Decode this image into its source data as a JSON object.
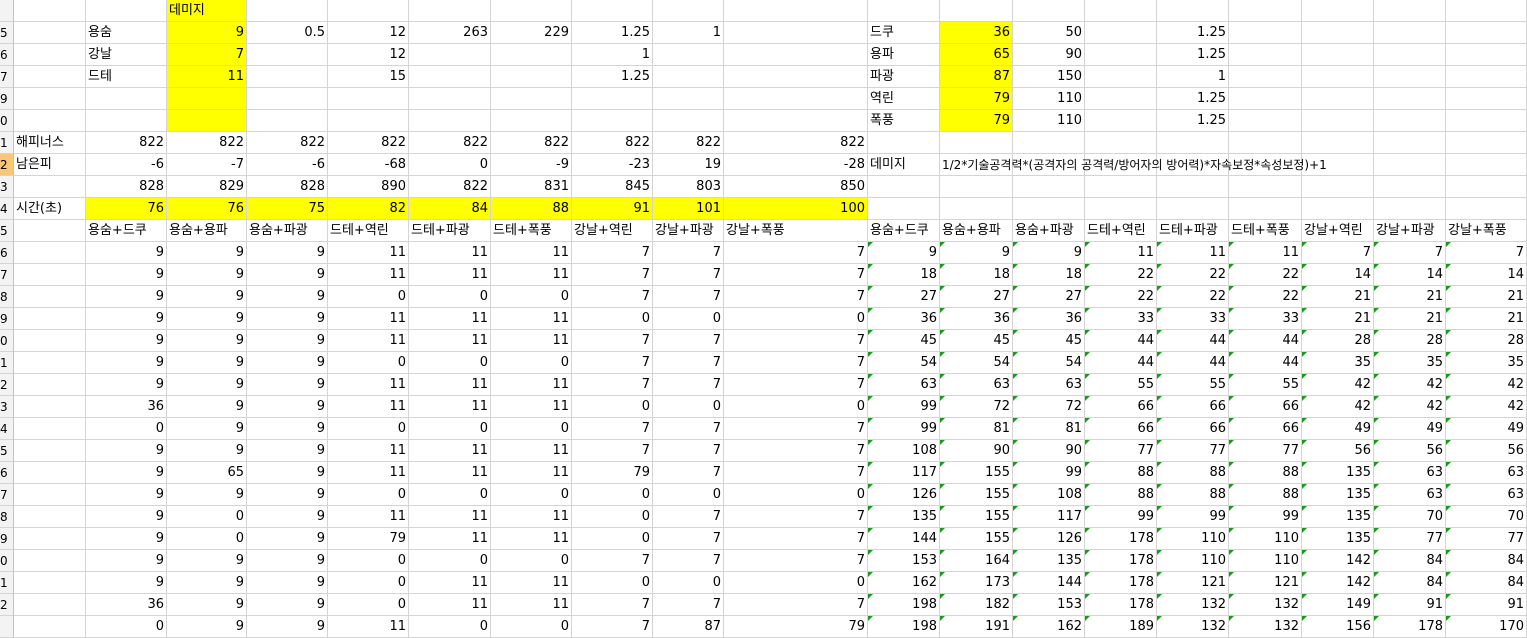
{
  "rows": [
    {
      "n": "",
      "cells": [
        {
          "c": 3,
          "v": "데미지",
          "t": 1
        },
        {
          "c": 3,
          "hl": 1,
          "only": 1
        }
      ]
    },
    {
      "n": "5",
      "cells": [
        {
          "c": 2,
          "v": "용숨",
          "t": 1
        },
        {
          "c": 3,
          "v": "9"
        },
        {
          "c": 4,
          "v": "0.5"
        },
        {
          "c": 5,
          "v": "12"
        },
        {
          "c": 6,
          "v": "263"
        },
        {
          "c": 7,
          "v": "229"
        },
        {
          "c": 8,
          "v": "1.25"
        },
        {
          "c": 9,
          "v": "1"
        },
        {
          "c": 11,
          "v": "드쿠",
          "t": 1
        },
        {
          "c": 12,
          "v": "36",
          "hl": 1
        },
        {
          "c": 13,
          "v": "50"
        },
        {
          "c": 15,
          "v": "1.25"
        }
      ]
    },
    {
      "n": "6",
      "cells": [
        {
          "c": 2,
          "v": "강날",
          "t": 1
        },
        {
          "c": 3,
          "v": "7"
        },
        {
          "c": 5,
          "v": "12"
        },
        {
          "c": 8,
          "v": "1"
        },
        {
          "c": 11,
          "v": "용파",
          "t": 1
        },
        {
          "c": 12,
          "v": "65",
          "hl": 1
        },
        {
          "c": 13,
          "v": "90"
        },
        {
          "c": 15,
          "v": "1.25"
        }
      ]
    },
    {
      "n": "7",
      "cells": [
        {
          "c": 2,
          "v": "드테",
          "t": 1
        },
        {
          "c": 3,
          "v": "11"
        },
        {
          "c": 5,
          "v": "15"
        },
        {
          "c": 8,
          "v": "1.25"
        },
        {
          "c": 11,
          "v": "파광",
          "t": 1
        },
        {
          "c": 12,
          "v": "87",
          "hl": 1
        },
        {
          "c": 13,
          "v": "150"
        },
        {
          "c": 15,
          "v": "1"
        }
      ]
    },
    {
      "n": "9",
      "cells": [
        {
          "c": 11,
          "v": "역린",
          "t": 1
        },
        {
          "c": 12,
          "v": "79",
          "hl": 1
        },
        {
          "c": 13,
          "v": "110"
        },
        {
          "c": 15,
          "v": "1.25"
        }
      ]
    },
    {
      "n": "0",
      "cells": [
        {
          "c": 11,
          "v": "폭풍",
          "t": 1
        },
        {
          "c": 12,
          "v": "79",
          "hl": 1
        },
        {
          "c": 13,
          "v": "110"
        },
        {
          "c": 15,
          "v": "1.25"
        }
      ]
    },
    {
      "n": "1",
      "cells": [
        {
          "c": 1,
          "v": "해피너스",
          "t": 1
        },
        {
          "c": 2,
          "v": "822"
        },
        {
          "c": 3,
          "v": "822"
        },
        {
          "c": 4,
          "v": "822"
        },
        {
          "c": 5,
          "v": "822"
        },
        {
          "c": 6,
          "v": "822"
        },
        {
          "c": 7,
          "v": "822"
        },
        {
          "c": 8,
          "v": "822"
        },
        {
          "c": 9,
          "v": "822"
        },
        {
          "c": 10,
          "v": "822"
        }
      ]
    },
    {
      "n": "2",
      "cells": [
        {
          "c": 1,
          "v": "남은피",
          "t": 1
        },
        {
          "c": 2,
          "v": "-6"
        },
        {
          "c": 3,
          "v": "-7"
        },
        {
          "c": 4,
          "v": "-6"
        },
        {
          "c": 5,
          "v": "-68"
        },
        {
          "c": 6,
          "v": "0"
        },
        {
          "c": 7,
          "v": "-9"
        },
        {
          "c": 8,
          "v": "-23"
        },
        {
          "c": 9,
          "v": "19"
        },
        {
          "c": 10,
          "v": "-28"
        },
        {
          "c": 11,
          "v": "데미지",
          "t": 1
        },
        {
          "c": 12,
          "v": "1/2*기술공격력*(공격자의 공격력/방어자의 방어력)*자속보정*속성보정)+1",
          "t": 1,
          "small": 1
        }
      ]
    },
    {
      "n": "3",
      "cells": [
        {
          "c": 2,
          "v": "828"
        },
        {
          "c": 3,
          "v": "829"
        },
        {
          "c": 4,
          "v": "828"
        },
        {
          "c": 5,
          "v": "890"
        },
        {
          "c": 6,
          "v": "822"
        },
        {
          "c": 7,
          "v": "831"
        },
        {
          "c": 8,
          "v": "845"
        },
        {
          "c": 9,
          "v": "803"
        },
        {
          "c": 10,
          "v": "850"
        }
      ]
    },
    {
      "n": "4",
      "cells": [
        {
          "c": 1,
          "v": "시간(초)",
          "t": 1
        },
        {
          "c": 2,
          "v": "76",
          "hl": 1
        },
        {
          "c": 3,
          "v": "76",
          "hl": 1
        },
        {
          "c": 4,
          "v": "75",
          "hl": 1
        },
        {
          "c": 5,
          "v": "82",
          "hl": 1
        },
        {
          "c": 6,
          "v": "84",
          "hl": 1
        },
        {
          "c": 7,
          "v": "88",
          "hl": 1
        },
        {
          "c": 8,
          "v": "91",
          "hl": 1
        },
        {
          "c": 9,
          "v": "101",
          "hl": 1
        },
        {
          "c": 10,
          "v": "100",
          "hl": 1
        }
      ]
    },
    {
      "n": "5",
      "cells": [
        {
          "c": 2,
          "v": "용숨+드쿠",
          "t": 1
        },
        {
          "c": 3,
          "v": "용숨+용파",
          "t": 1
        },
        {
          "c": 4,
          "v": "용숨+파광",
          "t": 1
        },
        {
          "c": 5,
          "v": "드테+역린",
          "t": 1
        },
        {
          "c": 6,
          "v": "드테+파광",
          "t": 1
        },
        {
          "c": 7,
          "v": "드테+폭풍",
          "t": 1
        },
        {
          "c": 8,
          "v": "강날+역린",
          "t": 1
        },
        {
          "c": 9,
          "v": "강날+파광",
          "t": 1
        },
        {
          "c": 10,
          "v": "강날+폭풍",
          "t": 1
        },
        {
          "c": 11,
          "v": "용숨+드쿠",
          "t": 1
        },
        {
          "c": 12,
          "v": "용숨+용파",
          "t": 1
        },
        {
          "c": 13,
          "v": "용숨+파광",
          "t": 1
        },
        {
          "c": 14,
          "v": "드테+역린",
          "t": 1
        },
        {
          "c": 15,
          "v": "드테+파광",
          "t": 1
        },
        {
          "c": 16,
          "v": "드테+폭풍",
          "t": 1
        },
        {
          "c": 17,
          "v": "강날+역린",
          "t": 1
        },
        {
          "c": 18,
          "v": "강날+파광",
          "t": 1
        },
        {
          "c": 19,
          "v": "강날+폭풍",
          "t": 1
        }
      ]
    }
  ],
  "data_rows": {
    "nums": [
      "6",
      "7",
      "8",
      "9",
      "0",
      "1",
      "2",
      "3",
      "4",
      "5",
      "6",
      "7",
      "8",
      "9",
      "0",
      "1",
      "2",
      ""
    ],
    "left": [
      [
        "9",
        "9",
        "9",
        "11",
        "11",
        "11",
        "7",
        "7",
        "7"
      ],
      [
        "9",
        "9",
        "9",
        "11",
        "11",
        "11",
        "7",
        "7",
        "7"
      ],
      [
        "9",
        "9",
        "9",
        "0",
        "0",
        "0",
        "7",
        "7",
        "7"
      ],
      [
        "9",
        "9",
        "9",
        "11",
        "11",
        "11",
        "0",
        "0",
        "0"
      ],
      [
        "9",
        "9",
        "9",
        "11",
        "11",
        "11",
        "7",
        "7",
        "7"
      ],
      [
        "9",
        "9",
        "9",
        "0",
        "0",
        "0",
        "7",
        "7",
        "7"
      ],
      [
        "9",
        "9",
        "9",
        "11",
        "11",
        "11",
        "7",
        "7",
        "7"
      ],
      [
        "36",
        "9",
        "9",
        "11",
        "11",
        "11",
        "0",
        "0",
        "0"
      ],
      [
        "0",
        "9",
        "9",
        "0",
        "0",
        "0",
        "7",
        "7",
        "7"
      ],
      [
        "9",
        "9",
        "9",
        "11",
        "11",
        "11",
        "7",
        "7",
        "7"
      ],
      [
        "9",
        "65",
        "9",
        "11",
        "11",
        "11",
        "79",
        "7",
        "7"
      ],
      [
        "9",
        "9",
        "9",
        "0",
        "0",
        "0",
        "0",
        "0",
        "0"
      ],
      [
        "9",
        "0",
        "9",
        "11",
        "11",
        "11",
        "0",
        "7",
        "7"
      ],
      [
        "9",
        "0",
        "9",
        "79",
        "11",
        "11",
        "0",
        "7",
        "7"
      ],
      [
        "9",
        "9",
        "9",
        "0",
        "0",
        "0",
        "7",
        "7",
        "7"
      ],
      [
        "9",
        "9",
        "9",
        "0",
        "11",
        "11",
        "0",
        "0",
        "0"
      ],
      [
        "36",
        "9",
        "9",
        "0",
        "11",
        "11",
        "7",
        "7",
        "7"
      ],
      [
        "0",
        "9",
        "9",
        "11",
        "0",
        "0",
        "7",
        "87",
        "79"
      ]
    ],
    "right": [
      [
        "9",
        "9",
        "9",
        "11",
        "11",
        "11",
        "7",
        "7",
        "7"
      ],
      [
        "18",
        "18",
        "18",
        "22",
        "22",
        "22",
        "14",
        "14",
        "14"
      ],
      [
        "27",
        "27",
        "27",
        "22",
        "22",
        "22",
        "21",
        "21",
        "21"
      ],
      [
        "36",
        "36",
        "36",
        "33",
        "33",
        "33",
        "21",
        "21",
        "21"
      ],
      [
        "45",
        "45",
        "45",
        "44",
        "44",
        "44",
        "28",
        "28",
        "28"
      ],
      [
        "54",
        "54",
        "54",
        "44",
        "44",
        "44",
        "35",
        "35",
        "35"
      ],
      [
        "63",
        "63",
        "63",
        "55",
        "55",
        "55",
        "42",
        "42",
        "42"
      ],
      [
        "99",
        "72",
        "72",
        "66",
        "66",
        "66",
        "42",
        "42",
        "42"
      ],
      [
        "99",
        "81",
        "81",
        "66",
        "66",
        "66",
        "49",
        "49",
        "49"
      ],
      [
        "108",
        "90",
        "90",
        "77",
        "77",
        "77",
        "56",
        "56",
        "56"
      ],
      [
        "117",
        "155",
        "99",
        "88",
        "88",
        "88",
        "135",
        "63",
        "63"
      ],
      [
        "126",
        "155",
        "108",
        "88",
        "88",
        "88",
        "135",
        "63",
        "63"
      ],
      [
        "135",
        "155",
        "117",
        "99",
        "99",
        "99",
        "135",
        "70",
        "70"
      ],
      [
        "144",
        "155",
        "126",
        "178",
        "110",
        "110",
        "135",
        "77",
        "77"
      ],
      [
        "153",
        "164",
        "135",
        "178",
        "110",
        "110",
        "142",
        "84",
        "84"
      ],
      [
        "162",
        "173",
        "144",
        "178",
        "121",
        "121",
        "142",
        "84",
        "84"
      ],
      [
        "198",
        "182",
        "153",
        "178",
        "132",
        "132",
        "149",
        "91",
        "91"
      ],
      [
        "198",
        "191",
        "162",
        "189",
        "132",
        "132",
        "156",
        "178",
        "170"
      ]
    ]
  }
}
